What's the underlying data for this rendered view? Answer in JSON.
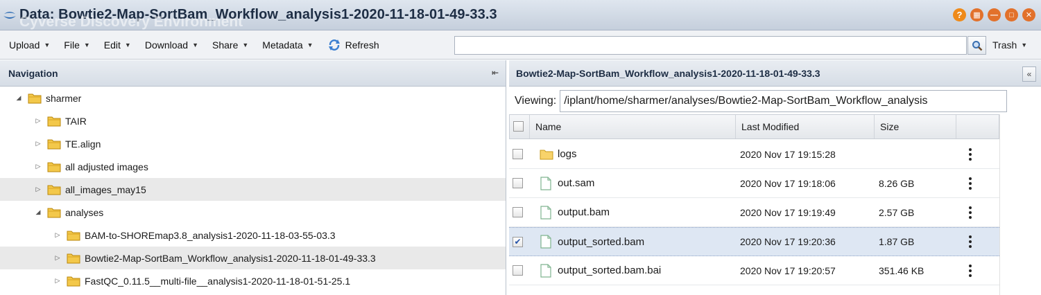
{
  "window": {
    "title": "Data: Bowtie2-Map-SortBam_Workflow_analysis1-2020-11-18-01-49-33.3",
    "ghost_text": "Cyverse Discovery Environment"
  },
  "toolbar": {
    "menus": [
      "Upload",
      "File",
      "Edit",
      "Download",
      "Share",
      "Metadata"
    ],
    "refresh_label": "Refresh",
    "search_value": "",
    "trash_label": "Trash"
  },
  "navigation": {
    "header": "Navigation",
    "tree": [
      {
        "label": "sharmer",
        "expanded": true,
        "level": 0,
        "highlighted": false
      },
      {
        "label": "TAIR",
        "expanded": false,
        "level": 1,
        "highlighted": false
      },
      {
        "label": "TE.align",
        "expanded": false,
        "level": 1,
        "highlighted": false
      },
      {
        "label": "all adjusted images",
        "expanded": false,
        "level": 1,
        "highlighted": false
      },
      {
        "label": "all_images_may15",
        "expanded": false,
        "level": 1,
        "highlighted": true
      },
      {
        "label": "analyses",
        "expanded": true,
        "level": 1,
        "highlighted": false
      },
      {
        "label": "BAM-to-SHOREmap3.8_analysis1-2020-11-18-03-55-03.3",
        "expanded": false,
        "level": 2,
        "highlighted": false
      },
      {
        "label": "Bowtie2-Map-SortBam_Workflow_analysis1-2020-11-18-01-49-33.3",
        "expanded": false,
        "level": 2,
        "highlighted": true
      },
      {
        "label": "FastQC_0.11.5__multi-file__analysis1-2020-11-18-01-51-25.1",
        "expanded": false,
        "level": 2,
        "highlighted": false
      }
    ]
  },
  "content": {
    "header": "Bowtie2-Map-SortBam_Workflow_analysis1-2020-11-18-01-49-33.3",
    "viewing_label": "Viewing:",
    "viewing_path": "/iplant/home/sharmer/analyses/Bowtie2-Map-SortBam_Workflow_analysis",
    "columns": {
      "name": "Name",
      "modified": "Last Modified",
      "size": "Size"
    },
    "files": [
      {
        "name": "logs",
        "type": "folder",
        "modified": "2020 Nov 17 19:15:28",
        "size": "",
        "checked": false
      },
      {
        "name": "out.sam",
        "type": "file",
        "modified": "2020 Nov 17 19:18:06",
        "size": "8.26 GB",
        "checked": false
      },
      {
        "name": "output.bam",
        "type": "file",
        "modified": "2020 Nov 17 19:19:49",
        "size": "2.57 GB",
        "checked": false
      },
      {
        "name": "output_sorted.bam",
        "type": "file",
        "modified": "2020 Nov 17 19:20:36",
        "size": "1.87 GB",
        "checked": true
      },
      {
        "name": "output_sorted.bam.bai",
        "type": "file",
        "modified": "2020 Nov 17 19:20:57",
        "size": "351.46 KB",
        "checked": false
      }
    ]
  },
  "colors": {
    "accent_orange": "#e2712b",
    "folder_yellow": "#f3c84a",
    "selected_row": "#dee7f3",
    "title_text": "#1d2d44"
  }
}
